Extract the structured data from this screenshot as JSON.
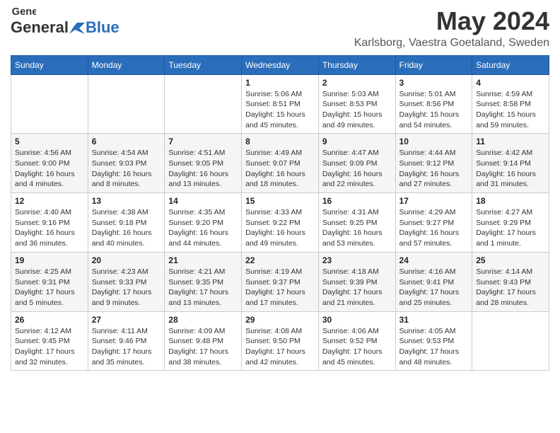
{
  "header": {
    "logo_general": "General",
    "logo_blue": "Blue",
    "month_title": "May 2024",
    "location": "Karlsborg, Vaestra Goetaland, Sweden"
  },
  "days_of_week": [
    "Sunday",
    "Monday",
    "Tuesday",
    "Wednesday",
    "Thursday",
    "Friday",
    "Saturday"
  ],
  "weeks": [
    [
      {
        "day": "",
        "info": ""
      },
      {
        "day": "",
        "info": ""
      },
      {
        "day": "",
        "info": ""
      },
      {
        "day": "1",
        "info": "Sunrise: 5:06 AM\nSunset: 8:51 PM\nDaylight: 15 hours\nand 45 minutes."
      },
      {
        "day": "2",
        "info": "Sunrise: 5:03 AM\nSunset: 8:53 PM\nDaylight: 15 hours\nand 49 minutes."
      },
      {
        "day": "3",
        "info": "Sunrise: 5:01 AM\nSunset: 8:56 PM\nDaylight: 15 hours\nand 54 minutes."
      },
      {
        "day": "4",
        "info": "Sunrise: 4:59 AM\nSunset: 8:58 PM\nDaylight: 15 hours\nand 59 minutes."
      }
    ],
    [
      {
        "day": "5",
        "info": "Sunrise: 4:56 AM\nSunset: 9:00 PM\nDaylight: 16 hours\nand 4 minutes."
      },
      {
        "day": "6",
        "info": "Sunrise: 4:54 AM\nSunset: 9:03 PM\nDaylight: 16 hours\nand 8 minutes."
      },
      {
        "day": "7",
        "info": "Sunrise: 4:51 AM\nSunset: 9:05 PM\nDaylight: 16 hours\nand 13 minutes."
      },
      {
        "day": "8",
        "info": "Sunrise: 4:49 AM\nSunset: 9:07 PM\nDaylight: 16 hours\nand 18 minutes."
      },
      {
        "day": "9",
        "info": "Sunrise: 4:47 AM\nSunset: 9:09 PM\nDaylight: 16 hours\nand 22 minutes."
      },
      {
        "day": "10",
        "info": "Sunrise: 4:44 AM\nSunset: 9:12 PM\nDaylight: 16 hours\nand 27 minutes."
      },
      {
        "day": "11",
        "info": "Sunrise: 4:42 AM\nSunset: 9:14 PM\nDaylight: 16 hours\nand 31 minutes."
      }
    ],
    [
      {
        "day": "12",
        "info": "Sunrise: 4:40 AM\nSunset: 9:16 PM\nDaylight: 16 hours\nand 36 minutes."
      },
      {
        "day": "13",
        "info": "Sunrise: 4:38 AM\nSunset: 9:18 PM\nDaylight: 16 hours\nand 40 minutes."
      },
      {
        "day": "14",
        "info": "Sunrise: 4:35 AM\nSunset: 9:20 PM\nDaylight: 16 hours\nand 44 minutes."
      },
      {
        "day": "15",
        "info": "Sunrise: 4:33 AM\nSunset: 9:22 PM\nDaylight: 16 hours\nand 49 minutes."
      },
      {
        "day": "16",
        "info": "Sunrise: 4:31 AM\nSunset: 9:25 PM\nDaylight: 16 hours\nand 53 minutes."
      },
      {
        "day": "17",
        "info": "Sunrise: 4:29 AM\nSunset: 9:27 PM\nDaylight: 16 hours\nand 57 minutes."
      },
      {
        "day": "18",
        "info": "Sunrise: 4:27 AM\nSunset: 9:29 PM\nDaylight: 17 hours\nand 1 minute."
      }
    ],
    [
      {
        "day": "19",
        "info": "Sunrise: 4:25 AM\nSunset: 9:31 PM\nDaylight: 17 hours\nand 5 minutes."
      },
      {
        "day": "20",
        "info": "Sunrise: 4:23 AM\nSunset: 9:33 PM\nDaylight: 17 hours\nand 9 minutes."
      },
      {
        "day": "21",
        "info": "Sunrise: 4:21 AM\nSunset: 9:35 PM\nDaylight: 17 hours\nand 13 minutes."
      },
      {
        "day": "22",
        "info": "Sunrise: 4:19 AM\nSunset: 9:37 PM\nDaylight: 17 hours\nand 17 minutes."
      },
      {
        "day": "23",
        "info": "Sunrise: 4:18 AM\nSunset: 9:39 PM\nDaylight: 17 hours\nand 21 minutes."
      },
      {
        "day": "24",
        "info": "Sunrise: 4:16 AM\nSunset: 9:41 PM\nDaylight: 17 hours\nand 25 minutes."
      },
      {
        "day": "25",
        "info": "Sunrise: 4:14 AM\nSunset: 9:43 PM\nDaylight: 17 hours\nand 28 minutes."
      }
    ],
    [
      {
        "day": "26",
        "info": "Sunrise: 4:12 AM\nSunset: 9:45 PM\nDaylight: 17 hours\nand 32 minutes."
      },
      {
        "day": "27",
        "info": "Sunrise: 4:11 AM\nSunset: 9:46 PM\nDaylight: 17 hours\nand 35 minutes."
      },
      {
        "day": "28",
        "info": "Sunrise: 4:09 AM\nSunset: 9:48 PM\nDaylight: 17 hours\nand 38 minutes."
      },
      {
        "day": "29",
        "info": "Sunrise: 4:08 AM\nSunset: 9:50 PM\nDaylight: 17 hours\nand 42 minutes."
      },
      {
        "day": "30",
        "info": "Sunrise: 4:06 AM\nSunset: 9:52 PM\nDaylight: 17 hours\nand 45 minutes."
      },
      {
        "day": "31",
        "info": "Sunrise: 4:05 AM\nSunset: 9:53 PM\nDaylight: 17 hours\nand 48 minutes."
      },
      {
        "day": "",
        "info": ""
      }
    ]
  ]
}
